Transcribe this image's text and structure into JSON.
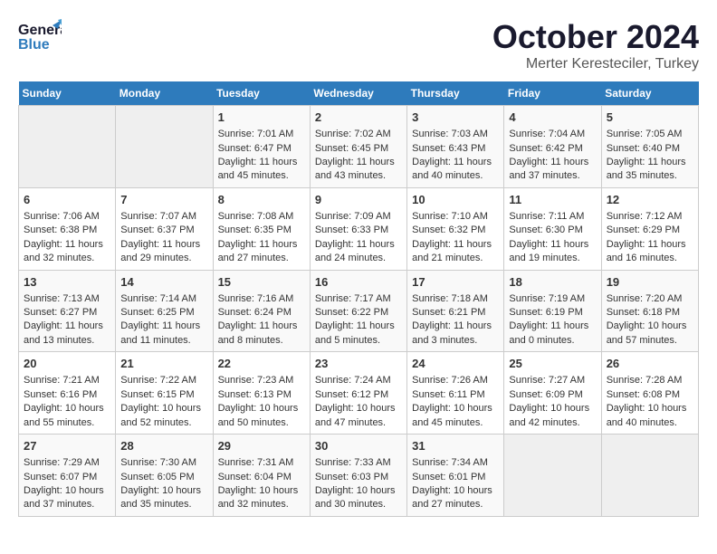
{
  "header": {
    "logo_general": "General",
    "logo_blue": "Blue",
    "month_title": "October 2024",
    "location": "Merter Keresteciler, Turkey"
  },
  "days_of_week": [
    "Sunday",
    "Monday",
    "Tuesday",
    "Wednesday",
    "Thursday",
    "Friday",
    "Saturday"
  ],
  "weeks": [
    [
      {
        "day": "",
        "sunrise": "",
        "sunset": "",
        "daylight": ""
      },
      {
        "day": "",
        "sunrise": "",
        "sunset": "",
        "daylight": ""
      },
      {
        "day": "1",
        "sunrise": "Sunrise: 7:01 AM",
        "sunset": "Sunset: 6:47 PM",
        "daylight": "Daylight: 11 hours and 45 minutes."
      },
      {
        "day": "2",
        "sunrise": "Sunrise: 7:02 AM",
        "sunset": "Sunset: 6:45 PM",
        "daylight": "Daylight: 11 hours and 43 minutes."
      },
      {
        "day": "3",
        "sunrise": "Sunrise: 7:03 AM",
        "sunset": "Sunset: 6:43 PM",
        "daylight": "Daylight: 11 hours and 40 minutes."
      },
      {
        "day": "4",
        "sunrise": "Sunrise: 7:04 AM",
        "sunset": "Sunset: 6:42 PM",
        "daylight": "Daylight: 11 hours and 37 minutes."
      },
      {
        "day": "5",
        "sunrise": "Sunrise: 7:05 AM",
        "sunset": "Sunset: 6:40 PM",
        "daylight": "Daylight: 11 hours and 35 minutes."
      }
    ],
    [
      {
        "day": "6",
        "sunrise": "Sunrise: 7:06 AM",
        "sunset": "Sunset: 6:38 PM",
        "daylight": "Daylight: 11 hours and 32 minutes."
      },
      {
        "day": "7",
        "sunrise": "Sunrise: 7:07 AM",
        "sunset": "Sunset: 6:37 PM",
        "daylight": "Daylight: 11 hours and 29 minutes."
      },
      {
        "day": "8",
        "sunrise": "Sunrise: 7:08 AM",
        "sunset": "Sunset: 6:35 PM",
        "daylight": "Daylight: 11 hours and 27 minutes."
      },
      {
        "day": "9",
        "sunrise": "Sunrise: 7:09 AM",
        "sunset": "Sunset: 6:33 PM",
        "daylight": "Daylight: 11 hours and 24 minutes."
      },
      {
        "day": "10",
        "sunrise": "Sunrise: 7:10 AM",
        "sunset": "Sunset: 6:32 PM",
        "daylight": "Daylight: 11 hours and 21 minutes."
      },
      {
        "day": "11",
        "sunrise": "Sunrise: 7:11 AM",
        "sunset": "Sunset: 6:30 PM",
        "daylight": "Daylight: 11 hours and 19 minutes."
      },
      {
        "day": "12",
        "sunrise": "Sunrise: 7:12 AM",
        "sunset": "Sunset: 6:29 PM",
        "daylight": "Daylight: 11 hours and 16 minutes."
      }
    ],
    [
      {
        "day": "13",
        "sunrise": "Sunrise: 7:13 AM",
        "sunset": "Sunset: 6:27 PM",
        "daylight": "Daylight: 11 hours and 13 minutes."
      },
      {
        "day": "14",
        "sunrise": "Sunrise: 7:14 AM",
        "sunset": "Sunset: 6:25 PM",
        "daylight": "Daylight: 11 hours and 11 minutes."
      },
      {
        "day": "15",
        "sunrise": "Sunrise: 7:16 AM",
        "sunset": "Sunset: 6:24 PM",
        "daylight": "Daylight: 11 hours and 8 minutes."
      },
      {
        "day": "16",
        "sunrise": "Sunrise: 7:17 AM",
        "sunset": "Sunset: 6:22 PM",
        "daylight": "Daylight: 11 hours and 5 minutes."
      },
      {
        "day": "17",
        "sunrise": "Sunrise: 7:18 AM",
        "sunset": "Sunset: 6:21 PM",
        "daylight": "Daylight: 11 hours and 3 minutes."
      },
      {
        "day": "18",
        "sunrise": "Sunrise: 7:19 AM",
        "sunset": "Sunset: 6:19 PM",
        "daylight": "Daylight: 11 hours and 0 minutes."
      },
      {
        "day": "19",
        "sunrise": "Sunrise: 7:20 AM",
        "sunset": "Sunset: 6:18 PM",
        "daylight": "Daylight: 10 hours and 57 minutes."
      }
    ],
    [
      {
        "day": "20",
        "sunrise": "Sunrise: 7:21 AM",
        "sunset": "Sunset: 6:16 PM",
        "daylight": "Daylight: 10 hours and 55 minutes."
      },
      {
        "day": "21",
        "sunrise": "Sunrise: 7:22 AM",
        "sunset": "Sunset: 6:15 PM",
        "daylight": "Daylight: 10 hours and 52 minutes."
      },
      {
        "day": "22",
        "sunrise": "Sunrise: 7:23 AM",
        "sunset": "Sunset: 6:13 PM",
        "daylight": "Daylight: 10 hours and 50 minutes."
      },
      {
        "day": "23",
        "sunrise": "Sunrise: 7:24 AM",
        "sunset": "Sunset: 6:12 PM",
        "daylight": "Daylight: 10 hours and 47 minutes."
      },
      {
        "day": "24",
        "sunrise": "Sunrise: 7:26 AM",
        "sunset": "Sunset: 6:11 PM",
        "daylight": "Daylight: 10 hours and 45 minutes."
      },
      {
        "day": "25",
        "sunrise": "Sunrise: 7:27 AM",
        "sunset": "Sunset: 6:09 PM",
        "daylight": "Daylight: 10 hours and 42 minutes."
      },
      {
        "day": "26",
        "sunrise": "Sunrise: 7:28 AM",
        "sunset": "Sunset: 6:08 PM",
        "daylight": "Daylight: 10 hours and 40 minutes."
      }
    ],
    [
      {
        "day": "27",
        "sunrise": "Sunrise: 7:29 AM",
        "sunset": "Sunset: 6:07 PM",
        "daylight": "Daylight: 10 hours and 37 minutes."
      },
      {
        "day": "28",
        "sunrise": "Sunrise: 7:30 AM",
        "sunset": "Sunset: 6:05 PM",
        "daylight": "Daylight: 10 hours and 35 minutes."
      },
      {
        "day": "29",
        "sunrise": "Sunrise: 7:31 AM",
        "sunset": "Sunset: 6:04 PM",
        "daylight": "Daylight: 10 hours and 32 minutes."
      },
      {
        "day": "30",
        "sunrise": "Sunrise: 7:33 AM",
        "sunset": "Sunset: 6:03 PM",
        "daylight": "Daylight: 10 hours and 30 minutes."
      },
      {
        "day": "31",
        "sunrise": "Sunrise: 7:34 AM",
        "sunset": "Sunset: 6:01 PM",
        "daylight": "Daylight: 10 hours and 27 minutes."
      },
      {
        "day": "",
        "sunrise": "",
        "sunset": "",
        "daylight": ""
      },
      {
        "day": "",
        "sunrise": "",
        "sunset": "",
        "daylight": ""
      }
    ]
  ]
}
